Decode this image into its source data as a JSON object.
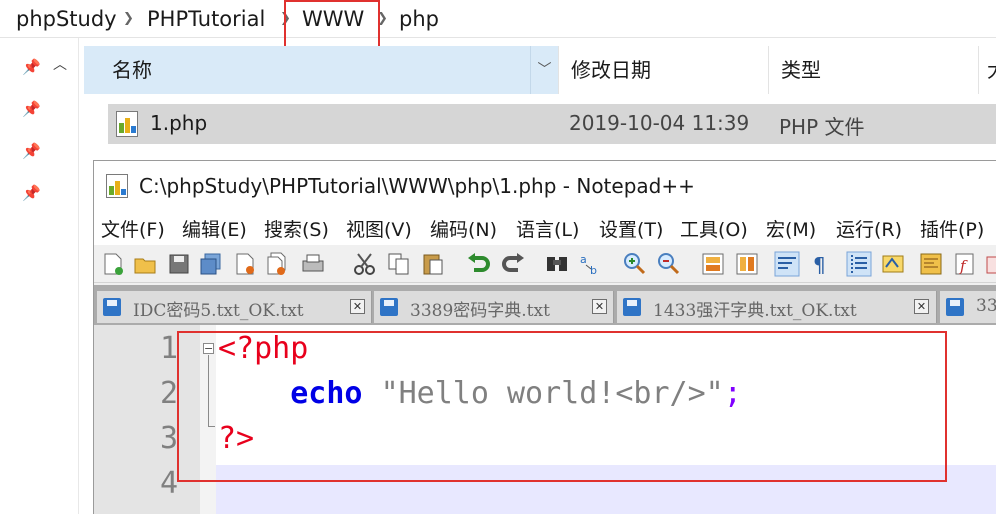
{
  "explorer": {
    "breadcrumb": [
      "phpStudy",
      "PHPTutorial",
      "WWW",
      "php"
    ],
    "columns": {
      "name": "名称",
      "date": "修改日期",
      "type": "类型",
      "more": "大"
    },
    "files": [
      {
        "name": "1.php",
        "date": "2019-10-04 11:39",
        "type": "PHP 文件"
      }
    ]
  },
  "notepad": {
    "title": "C:\\phpStudy\\PHPTutorial\\WWW\\php\\1.php - Notepad++",
    "menu": [
      "文件(F)",
      "编辑(E)",
      "搜索(S)",
      "视图(V)",
      "编码(N)",
      "语言(L)",
      "设置(T)",
      "工具(O)",
      "宏(M)",
      "运行(R)",
      "插件(P)"
    ],
    "tabs": [
      "IDC密码5.txt_OK.txt",
      "3389密码字典.txt",
      "1433强汗字典.txt_OK.txt",
      "33"
    ],
    "tab_close_glyph": "✕",
    "line_numbers": [
      "1",
      "2",
      "3",
      "4"
    ],
    "code": {
      "open_tag": "<?php",
      "indent": "    ",
      "echo": "echo",
      "space": " ",
      "string": "\"Hello world!<br/>\"",
      "semicolon": ";",
      "close_tag": "?>"
    }
  },
  "colors": {
    "highlight_red": "#e0312f",
    "php_tag": "#e8001c",
    "keyword": "#0000e6",
    "string": "#808080",
    "operator": "#8000ff",
    "header_blue": "#d9eaf8"
  }
}
